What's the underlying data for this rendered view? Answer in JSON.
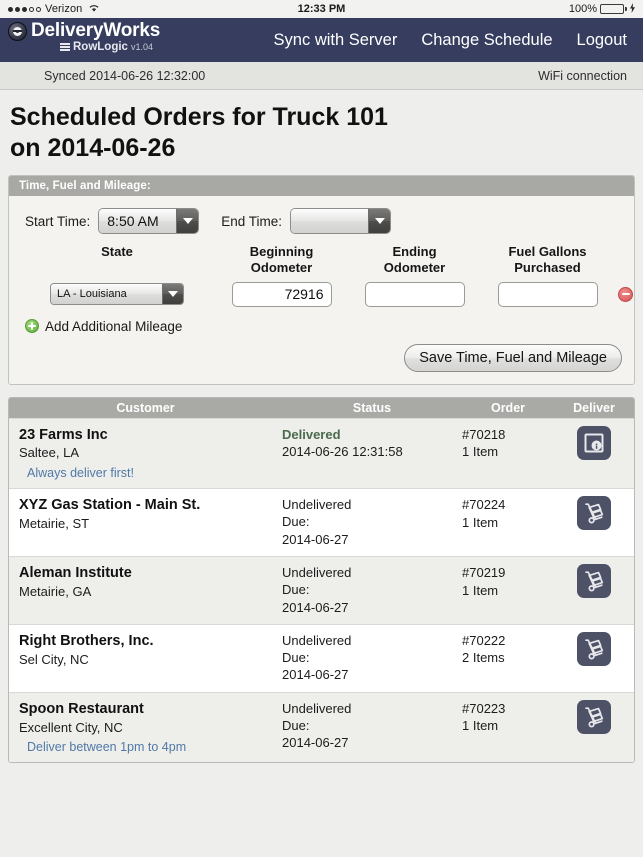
{
  "status_bar": {
    "carrier": "Verizon",
    "signal_filled": 3,
    "signal_empty": 2,
    "wifi_icon": "wifi-icon",
    "time": "12:33 PM",
    "battery_percent": "100%",
    "battery_color": "#4cd24c",
    "charging": true
  },
  "navbar": {
    "brand": "DeliveryWorks",
    "logo_icon": "tire-logo-icon",
    "sub_brand": "RowLogic",
    "version": "v1.04",
    "menu_icon": "hamburger-icon",
    "background": "#363d5f",
    "links": [
      {
        "label": "Sync with Server"
      },
      {
        "label": "Change Schedule"
      },
      {
        "label": "Logout"
      }
    ]
  },
  "sync_bar": {
    "synced_text": "Synced 2014-06-26 12:32:00",
    "connection": "WiFi connection"
  },
  "page": {
    "title_line1": "Scheduled Orders for Truck 101",
    "title_line2": "on 2014-06-26"
  },
  "fuel_panel": {
    "header": "Time, Fuel and Mileage:",
    "start_time_label": "Start Time:",
    "start_time_value": "8:50 AM",
    "end_time_label": "End Time:",
    "end_time_value": "",
    "columns": {
      "state": "State",
      "beginning_odometer_line1": "Beginning",
      "beginning_odometer_line2": "Odometer",
      "ending_odometer_line1": "Ending",
      "ending_odometer_line2": "Odometer",
      "fuel_gallons_line1": "Fuel Gallons",
      "fuel_gallons_line2": "Purchased"
    },
    "row": {
      "state_value": "LA - Louisiana",
      "beginning_odometer": "72916",
      "ending_odometer": "",
      "fuel_gallons": "",
      "remove_icon": "remove-circle-icon"
    },
    "add_mileage_label": "Add Additional Mileage",
    "add_icon": "add-circle-icon",
    "save_label": "Save Time, Fuel and Mileage"
  },
  "orders": {
    "headers": {
      "customer": "Customer",
      "status": "Status",
      "order": "Order",
      "deliver": "Deliver"
    },
    "rows": [
      {
        "customer": "23 Farms Inc",
        "city": "Saltee, LA",
        "note": "Always deliver first!",
        "status": "Delivered",
        "status_is_delivered": true,
        "status_line2": "2014-06-26 12:31:58",
        "status_line3": "",
        "order_number": "#70218",
        "item_count": "1 Item",
        "deliver_icon": "package-info-icon"
      },
      {
        "customer": "XYZ Gas Station - Main St.",
        "city": "Metairie, ST",
        "note": "",
        "status": "Undelivered",
        "status_is_delivered": false,
        "status_line2": "Due:",
        "status_line3": "2014-06-27",
        "order_number": "#70224",
        "item_count": "1 Item",
        "deliver_icon": "hand-truck-icon"
      },
      {
        "customer": "Aleman Institute",
        "city": "Metairie, GA",
        "note": "",
        "status": "Undelivered",
        "status_is_delivered": false,
        "status_line2": "Due:",
        "status_line3": "2014-06-27",
        "order_number": "#70219",
        "item_count": "1 Item",
        "deliver_icon": "hand-truck-icon"
      },
      {
        "customer": "Right Brothers, Inc.",
        "city": "Sel City, NC",
        "note": "",
        "status": "Undelivered",
        "status_is_delivered": false,
        "status_line2": "Due:",
        "status_line3": "2014-06-27",
        "order_number": "#70222",
        "item_count": "2 Items",
        "deliver_icon": "hand-truck-icon"
      },
      {
        "customer": "Spoon Restaurant",
        "city": "Excellent City, NC",
        "note": "Deliver between 1pm to 4pm",
        "status": "Undelivered",
        "status_is_delivered": false,
        "status_line2": "Due:",
        "status_line3": "2014-06-27",
        "order_number": "#70223",
        "item_count": "1 Item",
        "deliver_icon": "hand-truck-icon"
      }
    ]
  },
  "colors": {
    "nav_background": "#363d5f",
    "page_background": "#eeeeec",
    "panel_header": "#a8a8a5",
    "delivered_green": "#4a6b4f",
    "note_blue": "#5179a8"
  }
}
